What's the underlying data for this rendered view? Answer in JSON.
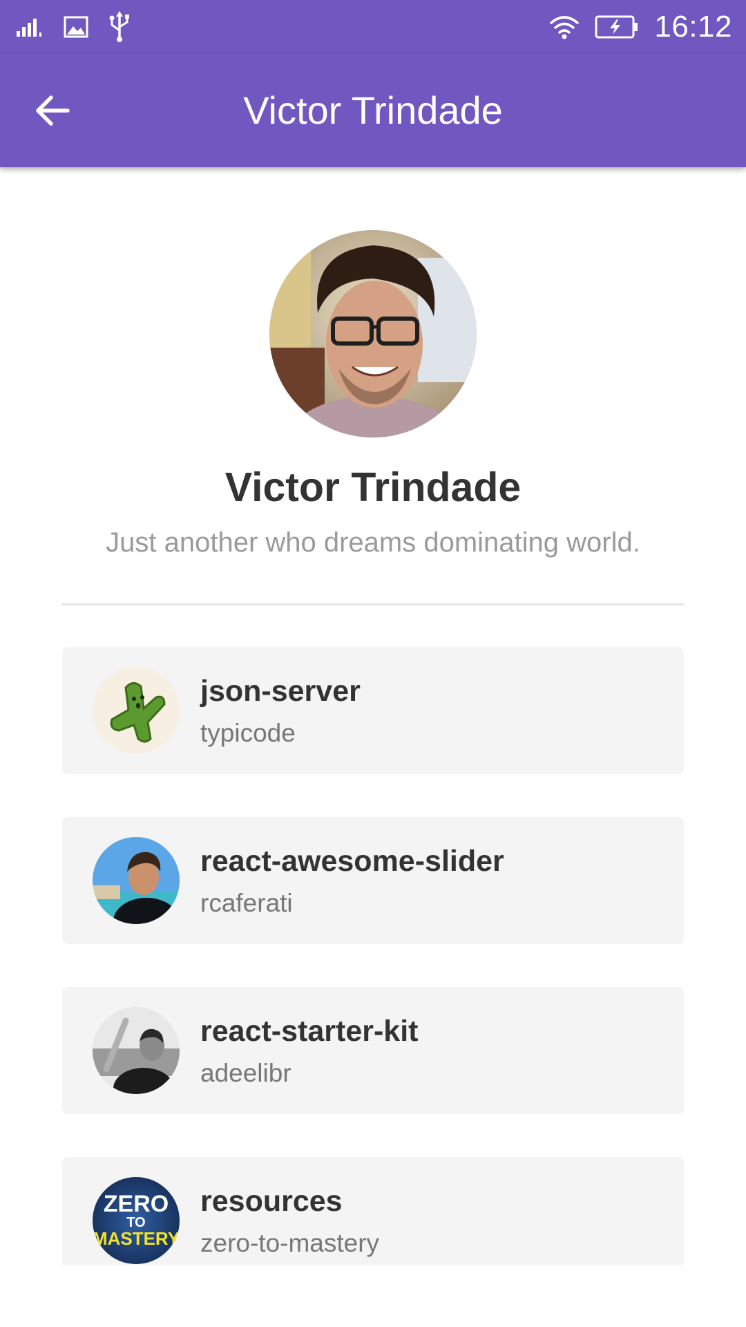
{
  "status_bar": {
    "time": "16:12",
    "icons": [
      "signal-icon",
      "image-notification-icon",
      "usb-icon",
      "wifi-icon",
      "battery-charging-icon"
    ]
  },
  "app_bar": {
    "title": "Victor Trindade",
    "back_icon": "arrow-back-icon",
    "background_color": "#7157c0"
  },
  "profile": {
    "name": "Victor Trindade",
    "bio": "Just another who dreams dominating world."
  },
  "repos": [
    {
      "name": "json-server",
      "owner": "typicode",
      "avatar": "cactus-avatar"
    },
    {
      "name": "react-awesome-slider",
      "owner": "rcaferati",
      "avatar": "person-avatar"
    },
    {
      "name": "react-starter-kit",
      "owner": "adeelibr",
      "avatar": "person-avatar"
    },
    {
      "name": "resources",
      "owner": "zero-to-mastery",
      "avatar": "zero-to-mastery-logo",
      "avatar_text": [
        "ZERO",
        "TO",
        "MASTERY"
      ]
    }
  ],
  "colors": {
    "accent": "#7157c0",
    "card_background": "#f4f4f4",
    "title_text": "#333333",
    "secondary_text": "#9a9a9a"
  }
}
